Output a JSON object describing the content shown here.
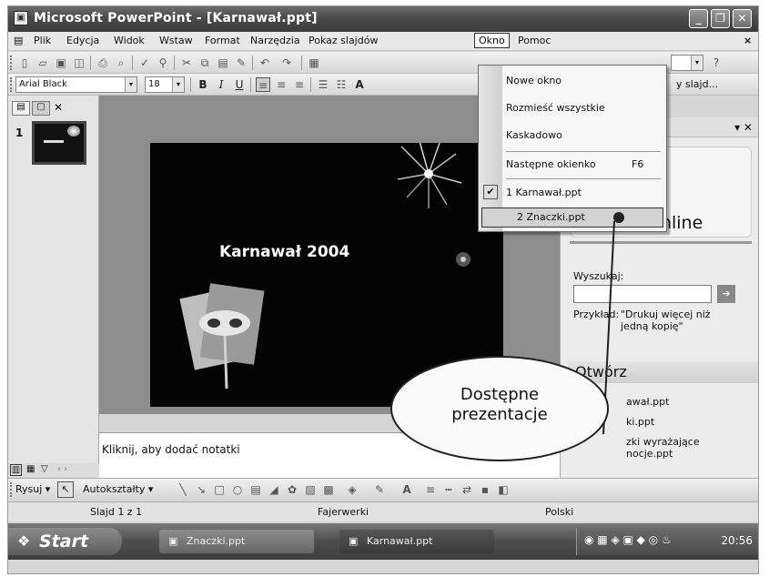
{
  "window": {
    "title": "Microsoft PowerPoint - [Karnawał.ppt]"
  },
  "menubar": {
    "items": [
      "Plik",
      "Edycja",
      "Widok",
      "Wstaw",
      "Format",
      "Narzędzia",
      "Pokaz slajdów",
      "Okno",
      "Pomoc"
    ],
    "open_item": "Okno",
    "close_glyph": "×"
  },
  "format_toolbar": {
    "font_name": "Arial Black",
    "font_size": "18",
    "bold": "B",
    "italic": "I",
    "underline": "U",
    "new_slide_partial": "y slajd..."
  },
  "window_menu": {
    "items": [
      {
        "label": "Nowe okno"
      },
      {
        "label": "Rozmieść wszystkie"
      },
      {
        "label": "Kaskadowo"
      },
      {
        "label": "Następne okienko",
        "shortcut": "F6"
      },
      {
        "label": "1 Karnawał.ppt",
        "checked": true
      },
      {
        "label": "2 Znaczki.ppt",
        "highlighted": true
      }
    ]
  },
  "outline_pane": {
    "slide_number": "1"
  },
  "slide": {
    "title": "Karnawał 2004"
  },
  "notes": {
    "placeholder": "Kliknij, aby dodać notatki"
  },
  "task_pane": {
    "online_label": "Online",
    "search_label": "Wyszukaj:",
    "example_label": "Przykład:",
    "example_text": "\"Drukuj więcej niż jedną kopię\"",
    "open_heading": "Otwórz",
    "recent_files": [
      "awał.ppt",
      "ki.ppt",
      "zki wyrażające",
      "nocje.ppt"
    ]
  },
  "drawing_toolbar": {
    "draw_label": "Rysuj",
    "autoshapes_label": "Autokształty"
  },
  "statusbar": {
    "slide_info": "Slajd 1 z 1",
    "design": "Fajerwerki",
    "language": "Polski"
  },
  "taskbar": {
    "start_label": "Start",
    "buttons": [
      "Znaczki.ppt",
      "Karnawał.ppt"
    ],
    "clock": "20:56"
  },
  "callout": {
    "text": "Dostępne prezentacje"
  }
}
